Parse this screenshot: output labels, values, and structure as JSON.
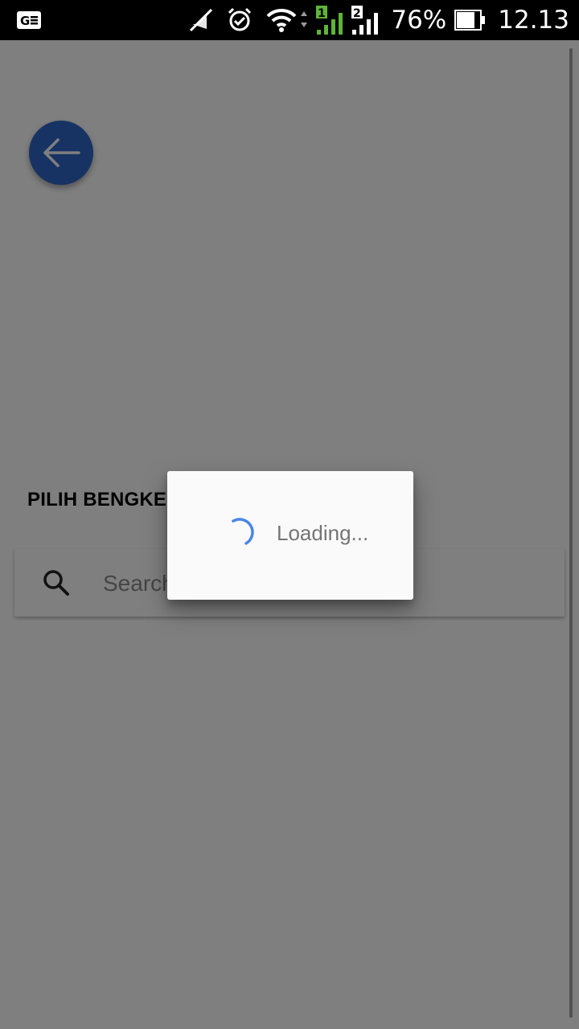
{
  "status_bar": {
    "battery_percent": "76%",
    "time": "12.13",
    "icons": [
      "sim-card-icon",
      "mute-icon",
      "alarm-icon",
      "wifi-icon",
      "signal-sim1-icon",
      "signal-sim2-icon",
      "battery-icon"
    ],
    "sim1_label": "1",
    "sim2_label": "2"
  },
  "back_button": {
    "icon": "arrow-left-icon",
    "color": "#2f66c8"
  },
  "sheet": {
    "title": "PILIH BENGKEL"
  },
  "search": {
    "placeholder": "Search",
    "value": "",
    "icon": "search-icon"
  },
  "dialog": {
    "loading_text": "Loading...",
    "spinner_color": "#4a86e8"
  }
}
